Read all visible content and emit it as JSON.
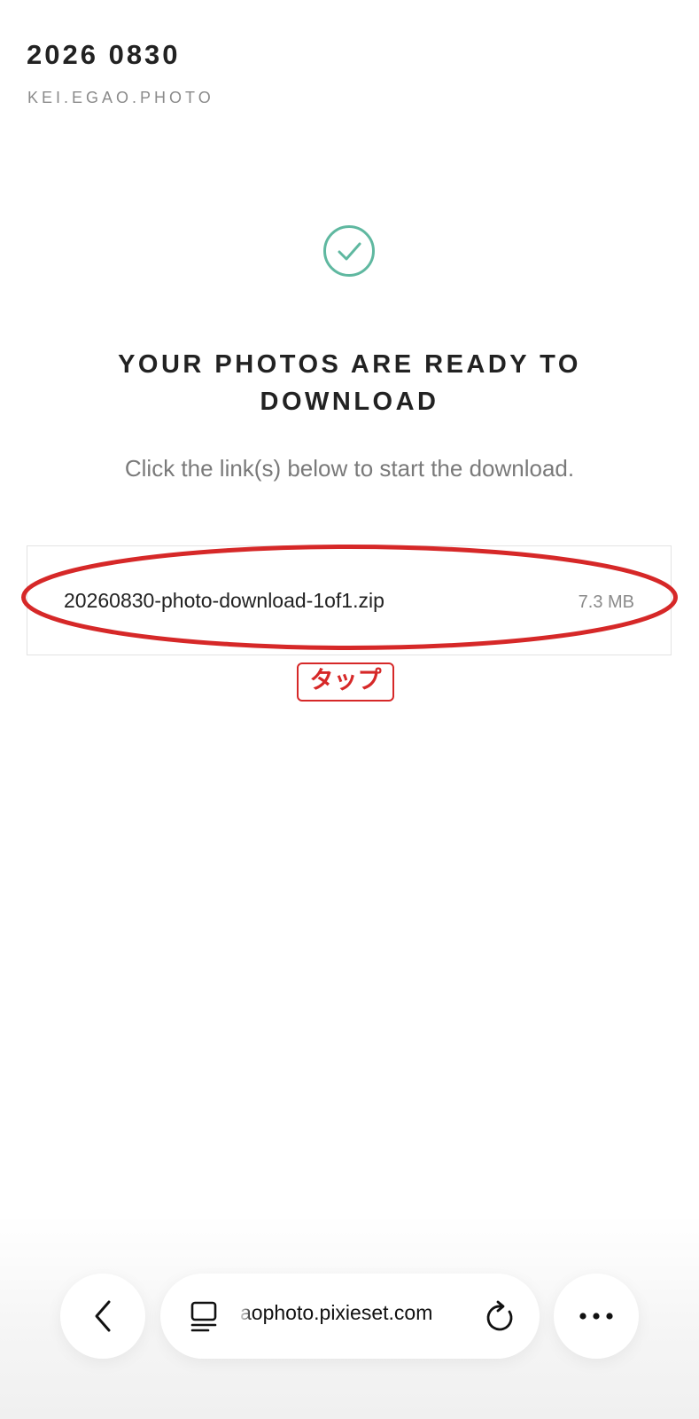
{
  "header": {
    "gallery_title": "2026 0830",
    "studio_name": "KEI.EGAO.PHOTO"
  },
  "status": {
    "icon": "check-circle-icon",
    "headline": "YOUR PHOTOS ARE READY TO DOWNLOAD",
    "subtext": "Click the link(s) below to start the download."
  },
  "files": [
    {
      "name": "20260830-photo-download-1of1.zip",
      "size": "7.3 MB"
    }
  ],
  "annotation": {
    "tap_label": "タップ",
    "color": "#d62828"
  },
  "browser": {
    "url_display": "aophoto.pixieset.com",
    "back_icon": "chevron-left-icon",
    "tabs_icon": "tabs-icon",
    "reload_icon": "reload-icon",
    "more_icon": "more-horizontal-icon"
  },
  "colors": {
    "accent_green": "#5fb8a0",
    "annotation_red": "#d62828",
    "text_dark": "#222222",
    "text_muted": "#7a7a7a"
  }
}
